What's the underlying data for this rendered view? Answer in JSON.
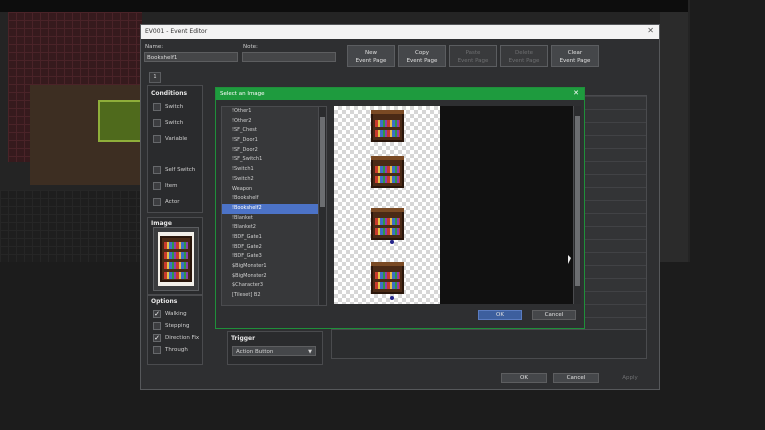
{
  "editor": {
    "title": "EV001 - Event Editor",
    "name_label": "Name:",
    "name_value": "Bookshelf1",
    "note_label": "Note:",
    "note_value": "",
    "page_tab": "1",
    "toolbar": [
      {
        "label": "New\nEvent Page",
        "enabled": true
      },
      {
        "label": "Copy\nEvent Page",
        "enabled": true
      },
      {
        "label": "Paste\nEvent Page",
        "enabled": false
      },
      {
        "label": "Delete\nEvent Page",
        "enabled": false
      },
      {
        "label": "Clear\nEvent Page",
        "enabled": true
      }
    ],
    "conditions": {
      "title": "Conditions",
      "items": [
        {
          "label": "Switch",
          "checked": false
        },
        {
          "label": "Switch",
          "checked": false
        },
        {
          "label": "Variable",
          "checked": false
        },
        {
          "label": "Self Switch",
          "checked": false
        },
        {
          "label": "Item",
          "checked": false
        },
        {
          "label": "Actor",
          "checked": false
        }
      ]
    },
    "image_title": "Image",
    "options": {
      "title": "Options",
      "items": [
        {
          "label": "Walking",
          "checked": true
        },
        {
          "label": "Stepping",
          "checked": false
        },
        {
          "label": "Direction Fix",
          "checked": true
        },
        {
          "label": "Through",
          "checked": false
        }
      ]
    },
    "trigger": {
      "title": "Trigger",
      "value": "Action Button"
    },
    "buttons": {
      "ok": "OK",
      "cancel": "Cancel",
      "apply": "Apply"
    }
  },
  "dialog": {
    "title": "Select an Image",
    "files": [
      "!Other1",
      "!Other2",
      "!SF_Chest",
      "!SF_Door1",
      "!SF_Door2",
      "!SF_Switch1",
      "!Switch1",
      "!Switch2",
      "Weapon",
      "!Bookshelf",
      "!Bookshelf2",
      "!Blanket",
      "!Blanket2",
      "!BDF_Gate1",
      "!BDF_Gate2",
      "!BDF_Gate3",
      "$BigMonster1",
      "$BigMonster2",
      "$Character3",
      "[Tileset] B2"
    ],
    "selected_index": 10,
    "ok": "OK",
    "cancel": "Cancel"
  },
  "colors": {
    "dialog_accent": "#1e9b3e",
    "selection": "#4c73c7",
    "window_bg": "#2e2f31"
  }
}
